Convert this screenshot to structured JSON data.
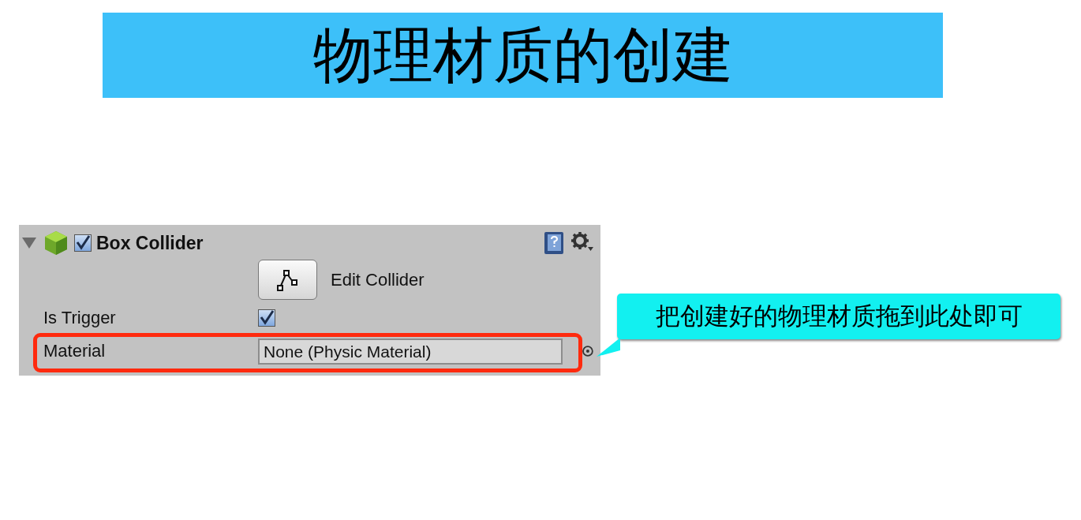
{
  "title": "物理材质的创建",
  "component": {
    "name": "Box Collider",
    "expanded": true,
    "enabled": true
  },
  "edit_button": {
    "label": "Edit Collider"
  },
  "fields": [
    {
      "kind": "checkbox",
      "label": "Is Trigger",
      "checked": true
    },
    {
      "kind": "object",
      "label": "Material",
      "value": "None (Physic Material)",
      "highlighted": true
    }
  ],
  "callout": {
    "text": "把创建好的物理材质拖到此处即可"
  }
}
